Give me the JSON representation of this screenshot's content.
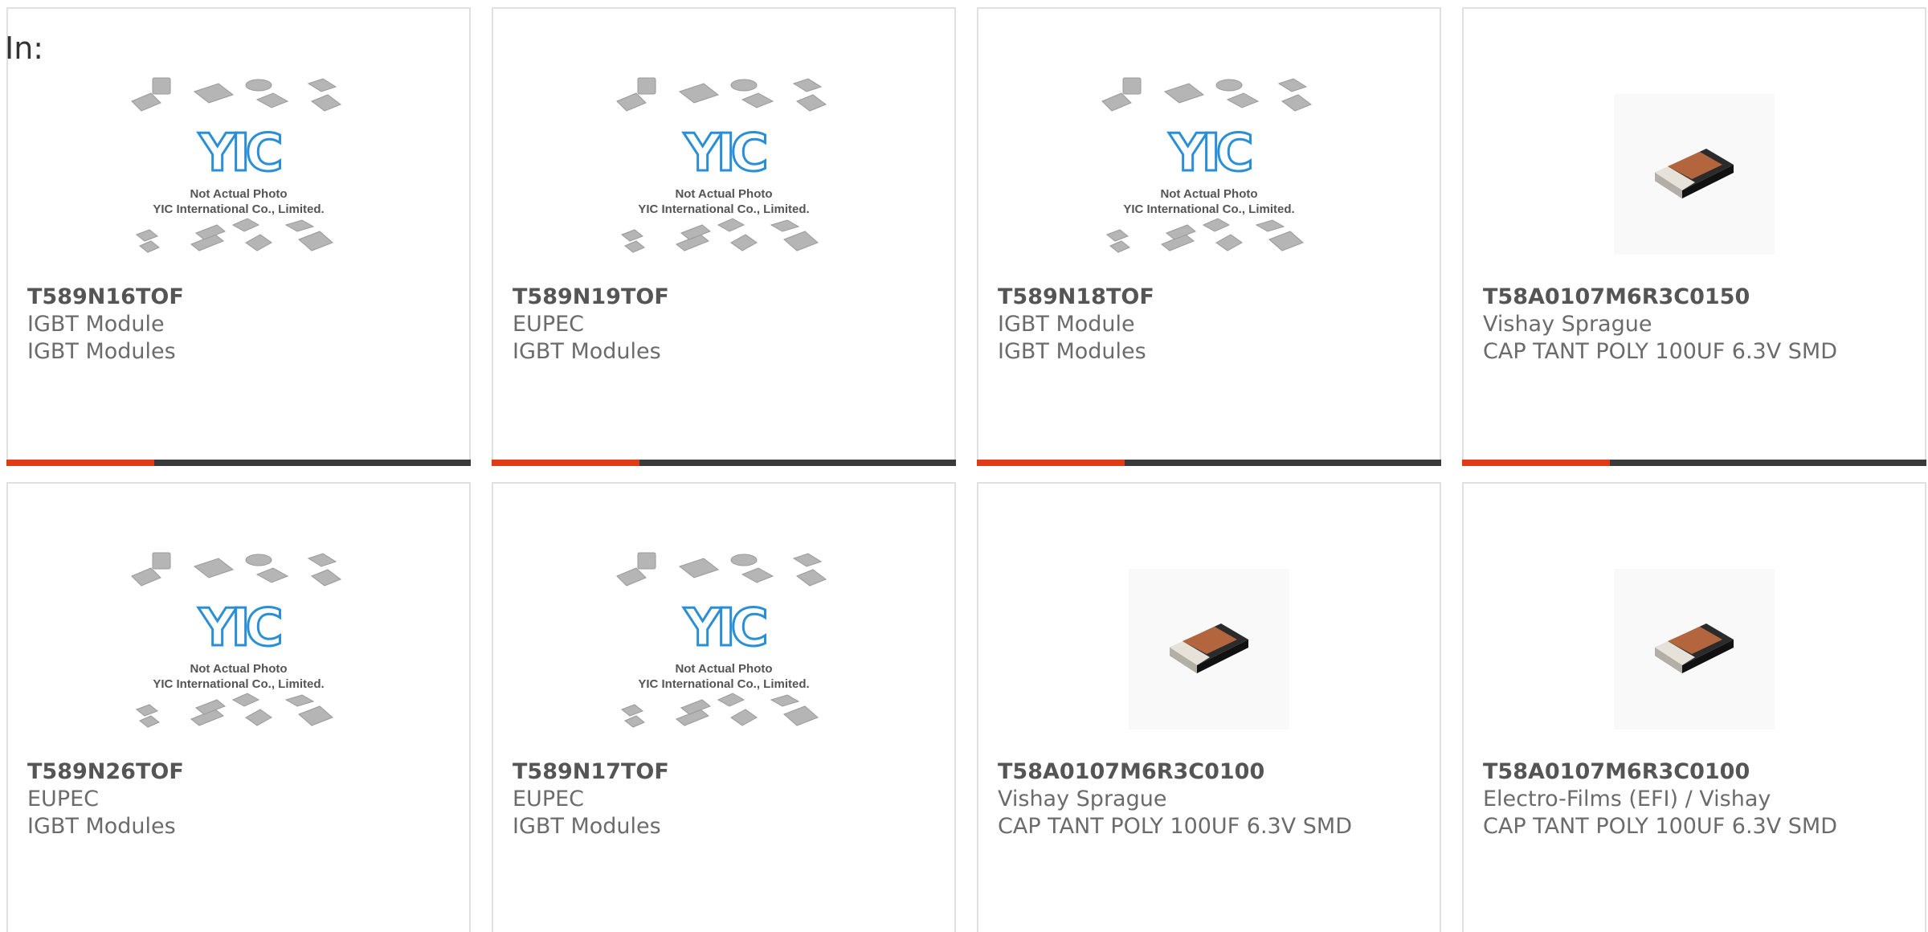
{
  "header": {
    "label": "In:"
  },
  "placeholder": {
    "brand": "YIC",
    "line1": "Not Actual Photo",
    "line2": "YIC International Co., Limited."
  },
  "colors": {
    "accent": "#e03a17",
    "bar": "#3a3a3a",
    "brand_blue": "#2a8fd6",
    "border": "#e0e0e0"
  },
  "products": [
    {
      "part": "T589N16TOF",
      "manufacturer": "IGBT Module",
      "description": "IGBT Modules",
      "image": "placeholder"
    },
    {
      "part": "T589N19TOF",
      "manufacturer": "EUPEC",
      "description": "IGBT Modules",
      "image": "placeholder"
    },
    {
      "part": "T589N18TOF",
      "manufacturer": "IGBT Module",
      "description": "IGBT Modules",
      "image": "placeholder"
    },
    {
      "part": "T58A0107M6R3C0150",
      "manufacturer": "Vishay Sprague",
      "description": "CAP TANT POLY 100UF 6.3V SMD",
      "image": "smd-capacitor"
    },
    {
      "part": "T589N26TOF",
      "manufacturer": "EUPEC",
      "description": "IGBT Modules",
      "image": "placeholder"
    },
    {
      "part": "T589N17TOF",
      "manufacturer": "EUPEC",
      "description": "IGBT Modules",
      "image": "placeholder"
    },
    {
      "part": "T58A0107M6R3C0100",
      "manufacturer": "Vishay Sprague",
      "description": "CAP TANT POLY 100UF 6.3V SMD",
      "image": "smd-capacitor"
    },
    {
      "part": "T58A0107M6R3C0100",
      "manufacturer": "Electro-Films (EFI) / Vishay",
      "description": "CAP TANT POLY 100UF 6.3V SMD",
      "image": "smd-capacitor"
    }
  ]
}
